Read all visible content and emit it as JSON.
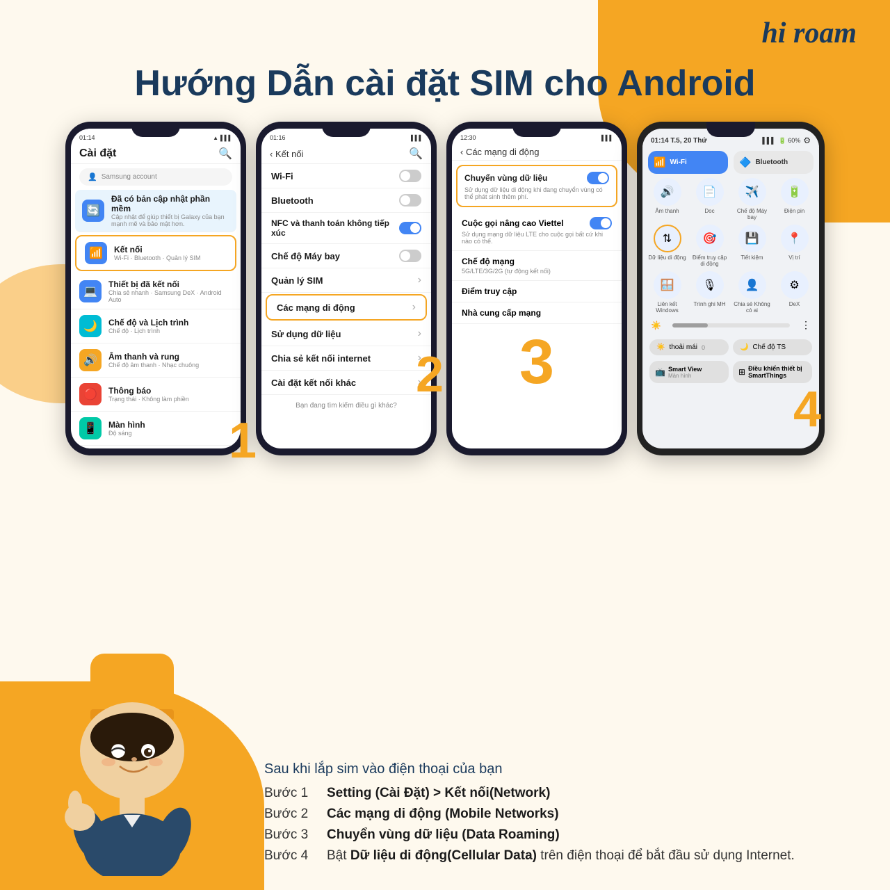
{
  "logo": {
    "text": "hi roam",
    "hi": "hi",
    "roam": "roam"
  },
  "title": "Hướng Dẫn cài đặt SIM cho Android",
  "phones": [
    {
      "id": "phone1",
      "time": "01:14",
      "screen_title": "Cài đặt",
      "has_search": true,
      "search_placeholder": "Samsung account",
      "items": [
        {
          "icon": "🔄",
          "icon_color": "blue",
          "title": "Đã có bản cập nhật phần mềm",
          "subtitle": "Cập nhật để giúp thiết bị Galaxy của bạn mạnh mẽ và bảo mật hơn.",
          "highlighted": false
        },
        {
          "icon": "📶",
          "icon_color": "blue",
          "title": "Kết nối",
          "subtitle": "Wi-Fi · Bluetooth · Quản lý SIM",
          "highlighted": true
        },
        {
          "icon": "💻",
          "icon_color": "blue",
          "title": "Thiết bị đã kết nối",
          "subtitle": "Chia sẻ nhanh · Samsung DeX · Android Auto",
          "highlighted": false
        },
        {
          "icon": "🌙",
          "icon_color": "teal",
          "title": "Chế độ và Lịch trình",
          "subtitle": "Chế độ · Lịch trình",
          "highlighted": false
        },
        {
          "icon": "🔔",
          "icon_color": "orange",
          "title": "Âm thanh và rung",
          "subtitle": "Chế độ âm thanh · Nhạc chuông",
          "highlighted": false
        },
        {
          "icon": "🔴",
          "icon_color": "red",
          "title": "Thông báo",
          "subtitle": "Trạng thái · Không làm phiền",
          "highlighted": false
        },
        {
          "icon": "📱",
          "icon_color": "blue",
          "title": "Màn hình",
          "subtitle": "Độ sáng",
          "highlighted": false
        }
      ],
      "step_num": "1"
    },
    {
      "id": "phone2",
      "time": "01:16",
      "screen_title": "Kết nối",
      "back": true,
      "items": [
        {
          "title": "Wi-Fi",
          "toggle": "off"
        },
        {
          "title": "Bluetooth",
          "toggle": "off"
        },
        {
          "title": "NFC và thanh toán không tiếp xúc",
          "toggle": "on"
        },
        {
          "title": "Chế độ Máy bay",
          "toggle": "off"
        },
        {
          "title": "Quản lý SIM",
          "toggle": null
        },
        {
          "title": "Các mạng di động",
          "toggle": null,
          "highlighted": true
        },
        {
          "title": "Sử dụng dữ liệu",
          "toggle": null
        },
        {
          "title": "Chia sẻ kết nối internet",
          "toggle": null
        },
        {
          "title": "Cài đặt kết nối khác",
          "toggle": null
        }
      ],
      "footer": "Bạn đang tìm kiếm điều gì khác?",
      "step_num": "2"
    },
    {
      "id": "phone3",
      "time": "12:30",
      "screen_title": "Các mạng di động",
      "back": true,
      "items": [
        {
          "title": "Chuyển vùng dữ liệu",
          "subtitle": "Sử dụng dữ liệu di động khi đang chuyển vùng có thể phát sinh thêm phí.",
          "toggle": "on",
          "highlighted": true
        },
        {
          "title": "Cuộc gọi nâng cao Viettel",
          "subtitle": "Sử dụng mạng dữ liệu LTE cho cuộc gọi bất cứ khi nào có thể.",
          "toggle": "on"
        },
        {
          "title": "Chế độ mạng",
          "subtitle": "5G/LTE/3G/2G (tự động kết nối)"
        },
        {
          "title": "Điểm truy cập"
        },
        {
          "title": "Nhà cung cấp mạng"
        }
      ],
      "step_num": "3"
    },
    {
      "id": "phone4",
      "time": "01:14 T.5, 20 Thứ",
      "quick_settings": [
        {
          "icon": "📶",
          "label": "Wi-Fi",
          "active": true
        },
        {
          "icon": "🔊",
          "label": "Âm thanh",
          "active": false
        },
        {
          "icon": "🔷",
          "label": "Bluetooth",
          "active": true
        },
        {
          "icon": "🔋",
          "label": "Điện pin",
          "active": false
        },
        {
          "icon": "📡",
          "label": "Dữ liệu di động",
          "active": false,
          "highlight": true
        },
        {
          "icon": "🎯",
          "label": "Điểm truy cập di động",
          "active": false
        },
        {
          "icon": "💾",
          "label": "Tiết kiệm",
          "active": false
        },
        {
          "icon": "📍",
          "label": "Vị trí",
          "active": false
        },
        {
          "icon": "🪟",
          "label": "Liên kết Windows",
          "active": false
        },
        {
          "icon": "🎙",
          "label": "Trình ghi MH",
          "active": false
        },
        {
          "icon": "👤",
          "label": "Chia sẻ Không có ai",
          "active": false
        },
        {
          "icon": "⚙",
          "label": "DeX",
          "active": false
        }
      ],
      "step_num": "4"
    }
  ],
  "bottom_text": {
    "intro": "Sau khi lắp sim vào điện thoại của bạn",
    "steps": [
      {
        "label": "Bước 1",
        "desc_plain": "",
        "desc_bold": "Setting (Cài Đặt) > Kết nối(Network)"
      },
      {
        "label": "Bước 2",
        "desc_plain": "",
        "desc_bold": "Các mạng di động (Mobile Networks)"
      },
      {
        "label": "Bước 3",
        "desc_plain": "",
        "desc_bold": "Chuyển vùng dữ liệu (Data Roaming)"
      },
      {
        "label": "Bước 4",
        "desc_plain": "Bật ",
        "desc_bold": "Dữ liệu di động(Cellular Data)",
        "desc_plain2": " trên điện thoại để bắt đầu sử dụng Internet."
      }
    ]
  },
  "colors": {
    "orange": "#f5a623",
    "dark_blue": "#1a3a5c",
    "background": "#fef9ee"
  }
}
